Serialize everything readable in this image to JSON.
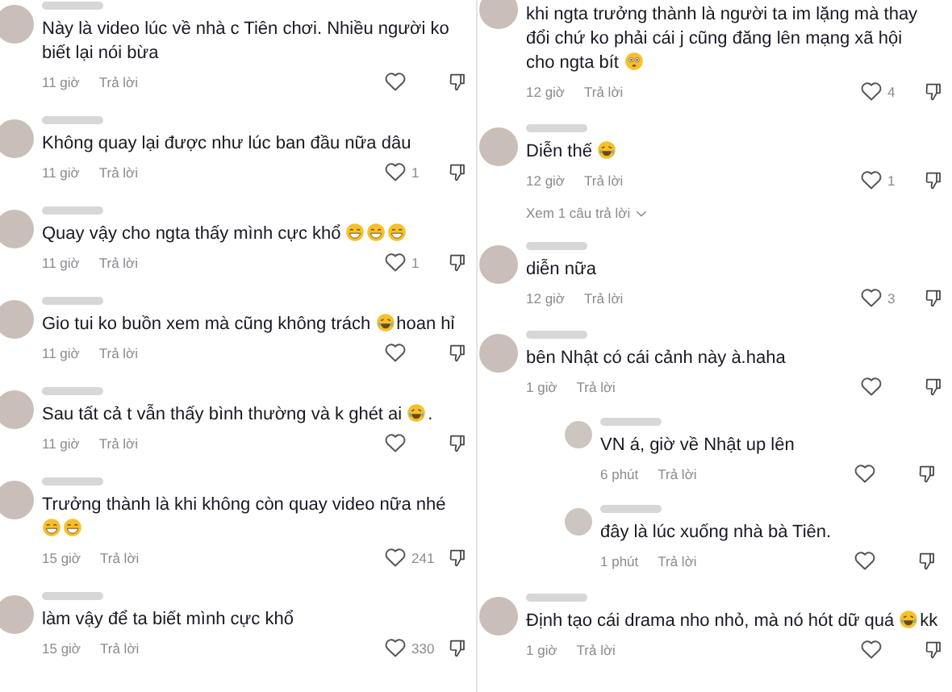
{
  "columns": [
    {
      "comments": [
        {
          "body": [
            {
              "kind": "text",
              "text": "Này là video lúc về nhà c Tiên chơi. Nhiều người ko biết lại nói bừa"
            }
          ],
          "time": "11 giờ",
          "reply": "Trả lời"
        },
        {
          "body": [
            {
              "kind": "text",
              "text": "Không quay lại được như lúc ban đầu nữa dâu"
            }
          ],
          "time": "11 giờ",
          "reply": "Trả lời",
          "likes": "1"
        },
        {
          "body": [
            {
              "kind": "text",
              "text": "Quay vậy cho ngta thấy mình cực khổ"
            },
            {
              "kind": "grin"
            },
            {
              "kind": "grin"
            },
            {
              "kind": "grin"
            }
          ],
          "time": "11 giờ",
          "reply": "Trả lời",
          "likes": "1"
        },
        {
          "body": [
            {
              "kind": "text",
              "text": "Gio tui ko buồn xem mà cũng không trách"
            },
            {
              "kind": "laugh"
            },
            {
              "kind": "text",
              "text": "hoan hỉ"
            }
          ],
          "time": "11 giờ",
          "reply": "Trả lời"
        },
        {
          "body": [
            {
              "kind": "text",
              "text": "Sau tất cả t vẫn thấy bình thường và k ghét ai"
            },
            {
              "kind": "laugh"
            },
            {
              "kind": "text",
              "text": "."
            }
          ],
          "time": "11 giờ",
          "reply": "Trả lời"
        },
        {
          "body": [
            {
              "kind": "text",
              "text": "Trưởng thành là khi không còn quay video nữa nhé"
            },
            {
              "kind": "grin"
            },
            {
              "kind": "grin"
            }
          ],
          "time": "15 giờ",
          "reply": "Trả lời",
          "likes": "241"
        },
        {
          "body": [
            {
              "kind": "text",
              "text": "làm vậy để ta biết mình cực khổ"
            }
          ],
          "time": "15 giờ",
          "reply": "Trả lời",
          "likes": "330"
        }
      ]
    },
    {
      "comments": [
        {
          "body": [
            {
              "kind": "text",
              "text": "khi ngta trưởng thành là người ta im lặng mà thay"
            },
            {
              "kind": "text",
              "text": "đổi chứ ko phải cái j cũng đăng lên mạng xã hội"
            },
            {
              "kind": "text",
              "text": "cho ngta bít"
            },
            {
              "kind": "flushed"
            }
          ],
          "time": "12 giờ",
          "reply": "Trả lời",
          "likes": "4"
        },
        {
          "body": [
            {
              "kind": "text",
              "text": "Diễn thế"
            },
            {
              "kind": "laugh"
            }
          ],
          "time": "12 giờ",
          "reply": "Trả lời",
          "likes": "1",
          "view_replies": "Xem 1 câu trả lời"
        },
        {
          "body": [
            {
              "kind": "text",
              "text": "diễn nữa"
            }
          ],
          "time": "12 giờ",
          "reply": "Trả lời",
          "likes": "3"
        },
        {
          "body": [
            {
              "kind": "text",
              "text": "bên Nhật có cái cảnh này à.haha"
            }
          ],
          "time": "1 giờ",
          "reply": "Trả lời",
          "replies": [
            {
              "body": [
                {
                  "kind": "text",
                  "text": "VN á, giờ về Nhật up lên"
                }
              ],
              "time": "6 phút",
              "reply": "Trả lời"
            },
            {
              "body": [
                {
                  "kind": "text",
                  "text": "đây là lúc xuống nhà bà Tiên."
                }
              ],
              "time": "1 phút",
              "reply": "Trả lời"
            }
          ]
        },
        {
          "body": [
            {
              "kind": "text",
              "text": "Định tạo cái drama nho nhỏ, mà nó hót dữ quá"
            },
            {
              "kind": "rofl"
            },
            {
              "kind": "text",
              "text": "kk"
            }
          ],
          "time": "1 giờ",
          "reply": "Trả lời"
        }
      ]
    }
  ]
}
